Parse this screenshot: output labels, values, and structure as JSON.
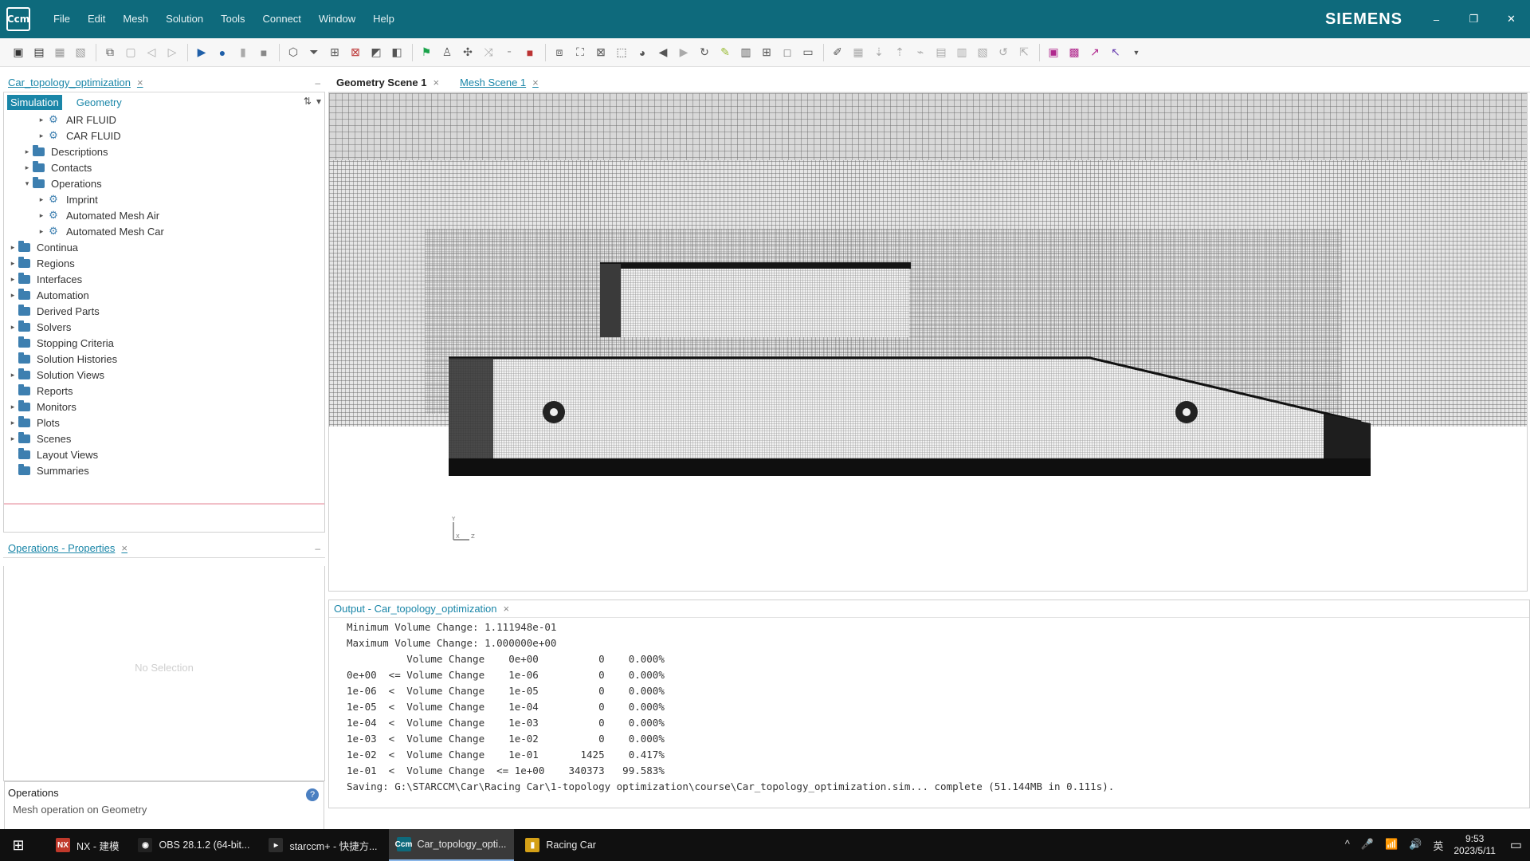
{
  "app": {
    "logo": "Ccm",
    "brand": "SIEMENS"
  },
  "menu": [
    "File",
    "Edit",
    "Mesh",
    "Solution",
    "Tools",
    "Connect",
    "Window",
    "Help"
  ],
  "window_controls": {
    "minimize": "–",
    "restore": "❐",
    "close": "✕"
  },
  "left": {
    "sim_tab": "Car_topology_optimization",
    "tree_tabs": [
      "Simulation",
      "Geometry"
    ],
    "tree": [
      {
        "label": "AIR FLUID",
        "level": 2,
        "caret": "▸",
        "type": "obj"
      },
      {
        "label": "CAR FLUID",
        "level": 2,
        "caret": "▸",
        "type": "obj"
      },
      {
        "label": "Descriptions",
        "level": 1,
        "caret": "▸",
        "type": "folder"
      },
      {
        "label": "Contacts",
        "level": 1,
        "caret": "▸",
        "type": "folder"
      },
      {
        "label": "Operations",
        "level": 1,
        "caret": "▾",
        "type": "folder"
      },
      {
        "label": "Imprint",
        "level": 2,
        "caret": "▸",
        "type": "obj"
      },
      {
        "label": "Automated Mesh Air",
        "level": 2,
        "caret": "▸",
        "type": "obj"
      },
      {
        "label": "Automated Mesh Car",
        "level": 2,
        "caret": "▸",
        "type": "obj"
      },
      {
        "label": "Continua",
        "level": 0,
        "caret": "▸",
        "type": "folder"
      },
      {
        "label": "Regions",
        "level": 0,
        "caret": "▸",
        "type": "folder"
      },
      {
        "label": "Interfaces",
        "level": 0,
        "caret": "▸",
        "type": "folder"
      },
      {
        "label": "Automation",
        "level": 0,
        "caret": "▸",
        "type": "folder"
      },
      {
        "label": "Derived Parts",
        "level": 0,
        "caret": "",
        "type": "folder"
      },
      {
        "label": "Solvers",
        "level": 0,
        "caret": "▸",
        "type": "folder"
      },
      {
        "label": "Stopping Criteria",
        "level": 0,
        "caret": "",
        "type": "folder"
      },
      {
        "label": "Solution Histories",
        "level": 0,
        "caret": "",
        "type": "folder"
      },
      {
        "label": "Solution Views",
        "level": 0,
        "caret": "▸",
        "type": "folder"
      },
      {
        "label": "Reports",
        "level": 0,
        "caret": "",
        "type": "folder"
      },
      {
        "label": "Monitors",
        "level": 0,
        "caret": "▸",
        "type": "folder"
      },
      {
        "label": "Plots",
        "level": 0,
        "caret": "▸",
        "type": "folder"
      },
      {
        "label": "Scenes",
        "level": 0,
        "caret": "▸",
        "type": "folder"
      },
      {
        "label": "Layout Views",
        "level": 0,
        "caret": "",
        "type": "folder"
      },
      {
        "label": "Summaries",
        "level": 0,
        "caret": "",
        "type": "folder"
      }
    ],
    "props_tab": "Operations - Properties",
    "props_empty": "No Selection",
    "props_info_title": "Operations",
    "props_info_desc": "Mesh operation on Geometry",
    "help_icon": "?"
  },
  "scene": {
    "tabs": [
      {
        "label": "Geometry Scene 1",
        "active": true
      },
      {
        "label": "Mesh Scene 1",
        "active": false
      }
    ],
    "axis": {
      "y": "Y",
      "x": "X",
      "z": "Z"
    }
  },
  "output": {
    "tab": "Output - Car_topology_optimization",
    "lines": [
      "Minimum Volume Change: 1.111948e-01",
      "Maximum Volume Change: 1.000000e+00",
      "          Volume Change    0e+00          0    0.000%",
      "0e+00  <= Volume Change    1e-06          0    0.000%",
      "1e-06  <  Volume Change    1e-05          0    0.000%",
      "1e-05  <  Volume Change    1e-04          0    0.000%",
      "1e-04  <  Volume Change    1e-03          0    0.000%",
      "1e-03  <  Volume Change    1e-02          0    0.000%",
      "1e-02  <  Volume Change    1e-01       1425    0.417%",
      "1e-01  <  Volume Change  <= 1e+00    340373   99.583%",
      "Saving: G:\\STARCCM\\Car\\Racing Car\\1-topology optimization\\course\\Car_topology_optimization.sim... complete (51.144MB in 0.111s)."
    ]
  },
  "taskbar": {
    "start": "⊞",
    "items": [
      {
        "label": "NX - 建模",
        "icon": "NX",
        "color": "#c0392b",
        "active": false
      },
      {
        "label": "OBS 28.1.2 (64-bit...",
        "icon": "◉",
        "color": "#222222",
        "active": false
      },
      {
        "label": "starccm+ - 快捷方...",
        "icon": "▸",
        "color": "#2d2d2d",
        "active": false
      },
      {
        "label": "Car_topology_opti...",
        "icon": "Ccm",
        "color": "#0e6a7c",
        "active": true
      },
      {
        "label": "Racing Car",
        "icon": "▮",
        "color": "#d4a017",
        "active": false
      }
    ],
    "tray": [
      "^",
      "🎤",
      "📶",
      "🔊",
      "英"
    ],
    "time": "9:53",
    "date": "2023/5/11"
  }
}
